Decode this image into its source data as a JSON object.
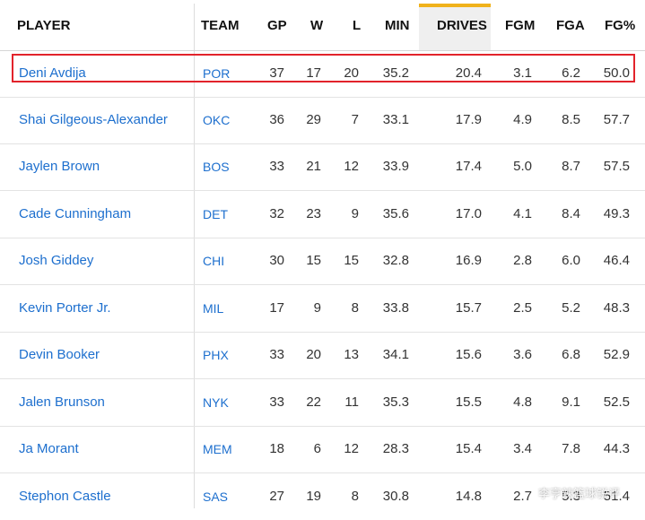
{
  "header": {
    "player": "PLAYER",
    "team": "TEAM",
    "gp": "GP",
    "w": "W",
    "l": "L",
    "min": "MIN",
    "drives": "DRIVES",
    "fgm": "FGM",
    "fga": "FGA",
    "fgp": "FG%"
  },
  "sorted_column": "DRIVES",
  "accent_color": "#f0b21b",
  "link_color": "#1d6fce",
  "highlight_color": "#e2232b",
  "rows": [
    {
      "player": "Deni Avdija",
      "team": "POR",
      "gp": "37",
      "w": "17",
      "l": "20",
      "min": "35.2",
      "drives": "20.4",
      "fgm": "3.1",
      "fga": "6.2",
      "fgp": "50.0"
    },
    {
      "player": "Shai Gilgeous-Alexander",
      "team": "OKC",
      "gp": "36",
      "w": "29",
      "l": "7",
      "min": "33.1",
      "drives": "17.9",
      "fgm": "4.9",
      "fga": "8.5",
      "fgp": "57.7"
    },
    {
      "player": "Jaylen Brown",
      "team": "BOS",
      "gp": "33",
      "w": "21",
      "l": "12",
      "min": "33.9",
      "drives": "17.4",
      "fgm": "5.0",
      "fga": "8.7",
      "fgp": "57.5"
    },
    {
      "player": "Cade Cunningham",
      "team": "DET",
      "gp": "32",
      "w": "23",
      "l": "9",
      "min": "35.6",
      "drives": "17.0",
      "fgm": "4.1",
      "fga": "8.4",
      "fgp": "49.3"
    },
    {
      "player": "Josh Giddey",
      "team": "CHI",
      "gp": "30",
      "w": "15",
      "l": "15",
      "min": "32.8",
      "drives": "16.9",
      "fgm": "2.8",
      "fga": "6.0",
      "fgp": "46.4"
    },
    {
      "player": "Kevin Porter Jr.",
      "team": "MIL",
      "gp": "17",
      "w": "9",
      "l": "8",
      "min": "33.8",
      "drives": "15.7",
      "fgm": "2.5",
      "fga": "5.2",
      "fgp": "48.3"
    },
    {
      "player": "Devin Booker",
      "team": "PHX",
      "gp": "33",
      "w": "20",
      "l": "13",
      "min": "34.1",
      "drives": "15.6",
      "fgm": "3.6",
      "fga": "6.8",
      "fgp": "52.9"
    },
    {
      "player": "Jalen Brunson",
      "team": "NYK",
      "gp": "33",
      "w": "22",
      "l": "11",
      "min": "35.3",
      "drives": "15.5",
      "fgm": "4.8",
      "fga": "9.1",
      "fgp": "52.5"
    },
    {
      "player": "Ja Morant",
      "team": "MEM",
      "gp": "18",
      "w": "6",
      "l": "12",
      "min": "28.3",
      "drives": "15.4",
      "fgm": "3.4",
      "fga": "7.8",
      "fgp": "44.3"
    },
    {
      "player": "Stephon Castle",
      "team": "SAS",
      "gp": "27",
      "w": "19",
      "l": "8",
      "min": "30.8",
      "drives": "14.8",
      "fgm": "2.7",
      "fga": "5.3",
      "fgp": "51.4"
    }
  ],
  "watermark": "李亨辣篮球锐评"
}
